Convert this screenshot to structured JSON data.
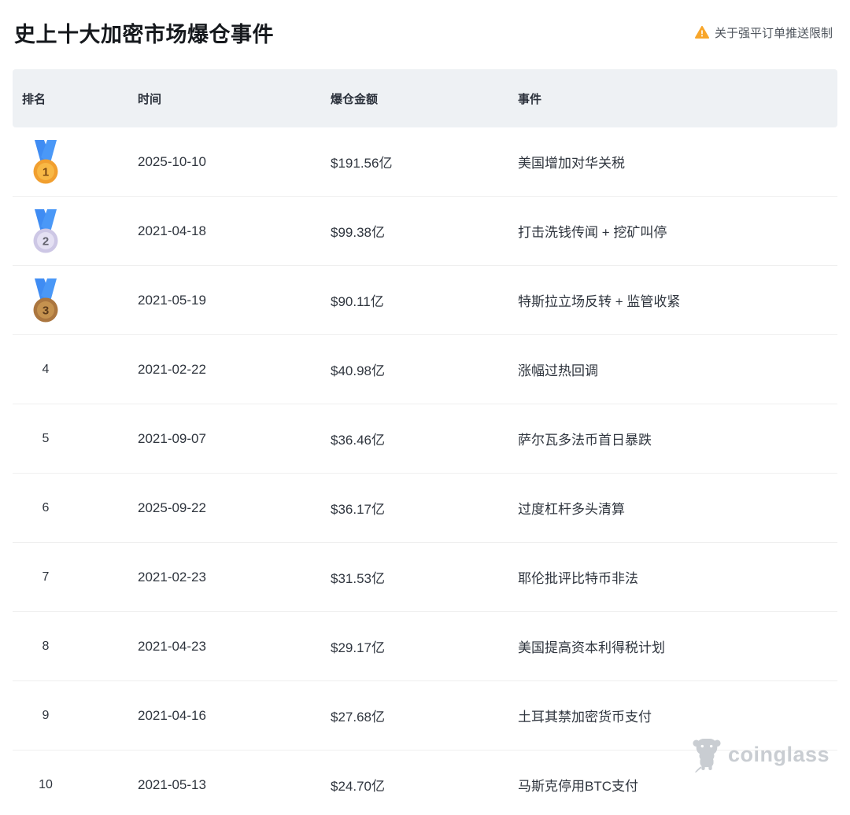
{
  "page": {
    "title": "史上十大加密市场爆仓事件"
  },
  "notice": {
    "label": "关于强平订单推送限制",
    "icon": "warning-triangle-icon",
    "icon_color": "#F8A62A"
  },
  "table": {
    "headers": {
      "rank": "排名",
      "time": "时间",
      "amount": "爆仓金额",
      "event": "事件"
    },
    "rows": [
      {
        "rank": "1",
        "medal": "gold",
        "date": "2025-10-10",
        "amount": "$191.56亿",
        "event": "美国增加对华关税"
      },
      {
        "rank": "2",
        "medal": "silver",
        "date": "2021-04-18",
        "amount": "$99.38亿",
        "event": "打击洗钱传闻 + 挖矿叫停"
      },
      {
        "rank": "3",
        "medal": "bronze",
        "date": "2021-05-19",
        "amount": "$90.11亿",
        "event": "特斯拉立场反转 + 监管收紧"
      },
      {
        "rank": "4",
        "medal": null,
        "date": "2021-02-22",
        "amount": "$40.98亿",
        "event": "涨幅过热回调"
      },
      {
        "rank": "5",
        "medal": null,
        "date": "2021-09-07",
        "amount": "$36.46亿",
        "event": "萨尔瓦多法币首日暴跌"
      },
      {
        "rank": "6",
        "medal": null,
        "date": "2025-09-22",
        "amount": "$36.17亿",
        "event": "过度杠杆多头清算"
      },
      {
        "rank": "7",
        "medal": null,
        "date": "2021-02-23",
        "amount": "$31.53亿",
        "event": "耶伦批评比特币非法"
      },
      {
        "rank": "8",
        "medal": null,
        "date": "2021-04-23",
        "amount": "$29.17亿",
        "event": "美国提高资本利得税计划"
      },
      {
        "rank": "9",
        "medal": null,
        "date": "2021-04-16",
        "amount": "$27.68亿",
        "event": "土耳其禁加密货币支付"
      },
      {
        "rank": "10",
        "medal": null,
        "date": "2021-05-13",
        "amount": "$24.70亿",
        "event": "马斯克停用BTC支付"
      }
    ]
  },
  "watermark": {
    "label": "coinglass",
    "logo": "bull-icon",
    "color": "#C9CDD2"
  },
  "colors": {
    "header_bg": "#EEF1F4",
    "text_dark": "#2F353E",
    "divider": "#EFEFEF",
    "ribbon_blue": "#3F8CF3",
    "medal_gold": "#F19F2F",
    "medal_silver": "#CDC7E5",
    "medal_bronze": "#AB763F"
  }
}
